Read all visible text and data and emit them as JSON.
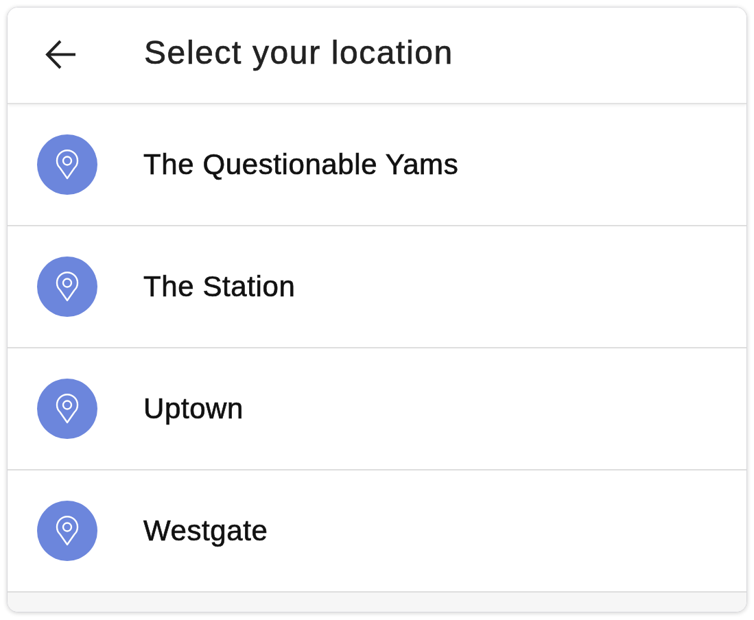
{
  "header": {
    "title": "Select your location"
  },
  "locations": [
    {
      "name": "The Questionable Yams"
    },
    {
      "name": "The Station"
    },
    {
      "name": "Uptown"
    },
    {
      "name": "Westgate"
    }
  ]
}
